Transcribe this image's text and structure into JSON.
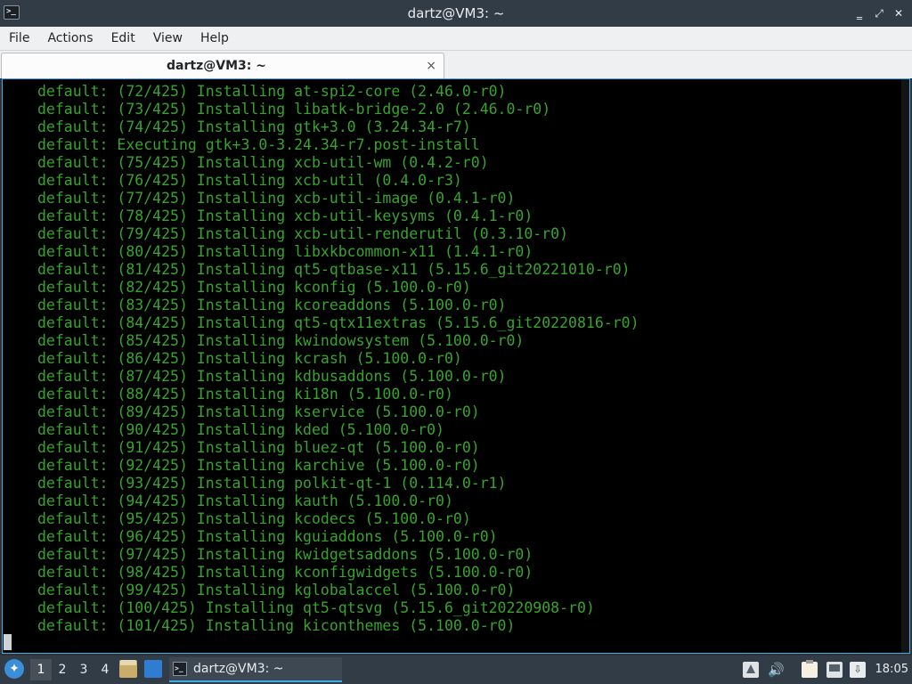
{
  "window": {
    "title": "dartz@VM3: ~",
    "app_icon_glyph": ">_",
    "controls": {
      "minimize": "‗",
      "maximize": "⤢",
      "close": "✕"
    }
  },
  "menu": [
    "File",
    "Actions",
    "Edit",
    "View",
    "Help"
  ],
  "tab": {
    "label": "dartz@VM3: ~",
    "close_glyph": "×"
  },
  "terminal": {
    "text_color": "#38a32d",
    "lines": [
      "default: (72/425) Installing at-spi2-core (2.46.0-r0)",
      "default: (73/425) Installing libatk-bridge-2.0 (2.46.0-r0)",
      "default: (74/425) Installing gtk+3.0 (3.24.34-r7)",
      "default: Executing gtk+3.0-3.24.34-r7.post-install",
      "default: (75/425) Installing xcb-util-wm (0.4.2-r0)",
      "default: (76/425) Installing xcb-util (0.4.0-r3)",
      "default: (77/425) Installing xcb-util-image (0.4.1-r0)",
      "default: (78/425) Installing xcb-util-keysyms (0.4.1-r0)",
      "default: (79/425) Installing xcb-util-renderutil (0.3.10-r0)",
      "default: (80/425) Installing libxkbcommon-x11 (1.4.1-r0)",
      "default: (81/425) Installing qt5-qtbase-x11 (5.15.6_git20221010-r0)",
      "default: (82/425) Installing kconfig (5.100.0-r0)",
      "default: (83/425) Installing kcoreaddons (5.100.0-r0)",
      "default: (84/425) Installing qt5-qtx11extras (5.15.6_git20220816-r0)",
      "default: (85/425) Installing kwindowsystem (5.100.0-r0)",
      "default: (86/425) Installing kcrash (5.100.0-r0)",
      "default: (87/425) Installing kdbusaddons (5.100.0-r0)",
      "default: (88/425) Installing ki18n (5.100.0-r0)",
      "default: (89/425) Installing kservice (5.100.0-r0)",
      "default: (90/425) Installing kded (5.100.0-r0)",
      "default: (91/425) Installing bluez-qt (5.100.0-r0)",
      "default: (92/425) Installing karchive (5.100.0-r0)",
      "default: (93/425) Installing polkit-qt-1 (0.114.0-r1)",
      "default: (94/425) Installing kauth (5.100.0-r0)",
      "default: (95/425) Installing kcodecs (5.100.0-r0)",
      "default: (96/425) Installing kguiaddons (5.100.0-r0)",
      "default: (97/425) Installing kwidgetsaddons (5.100.0-r0)",
      "default: (98/425) Installing kconfigwidgets (5.100.0-r0)",
      "default: (99/425) Installing kglobalaccel (5.100.0-r0)",
      "default: (100/425) Installing qt5-qtsvg (5.15.6_git20220908-r0)",
      "default: (101/425) Installing kiconthemes (5.100.0-r0)"
    ]
  },
  "taskbar": {
    "desktops": [
      "1",
      "2",
      "3",
      "4"
    ],
    "active_desktop": "1",
    "task_label": "dartz@VM3: ~",
    "volume_glyph": "🔊",
    "update_glyph": "⇩",
    "clock": "18:05"
  },
  "icons": {
    "app": "terminal-icon",
    "start": "start-menu-icon",
    "files": "file-manager-icon",
    "desktop": "show-desktop-icon",
    "network": "network-icon",
    "volume": "volume-icon",
    "clipboard": "clipboard-icon",
    "monitor": "monitor-icon",
    "update": "update-icon"
  }
}
